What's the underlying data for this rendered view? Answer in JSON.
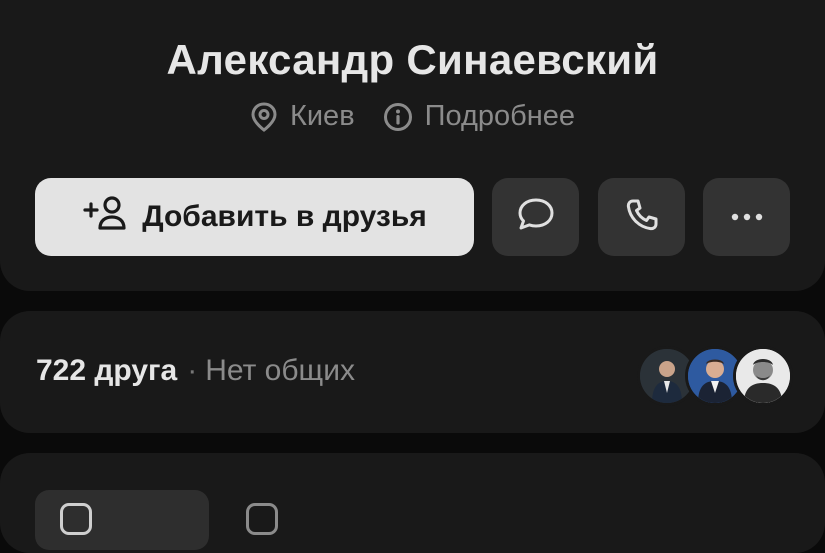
{
  "profile": {
    "name": "Александр Синаевский",
    "city": "Киев",
    "details_link": "Подробнее"
  },
  "actions": {
    "add_friend_label": "Добавить в друзья",
    "message_icon": "message-bubble-icon",
    "call_icon": "phone-icon",
    "more_icon": "more-dots-icon"
  },
  "friends": {
    "count_label": "722 друга",
    "separator": "·",
    "mutual_label": "Нет общих"
  },
  "colors": {
    "background": "#0a0a0a",
    "card": "#191919",
    "primary_button": "#e3e3e3",
    "icon_button": "#333333",
    "text_primary": "#e6e6e6",
    "text_secondary": "#8b8b8b"
  }
}
